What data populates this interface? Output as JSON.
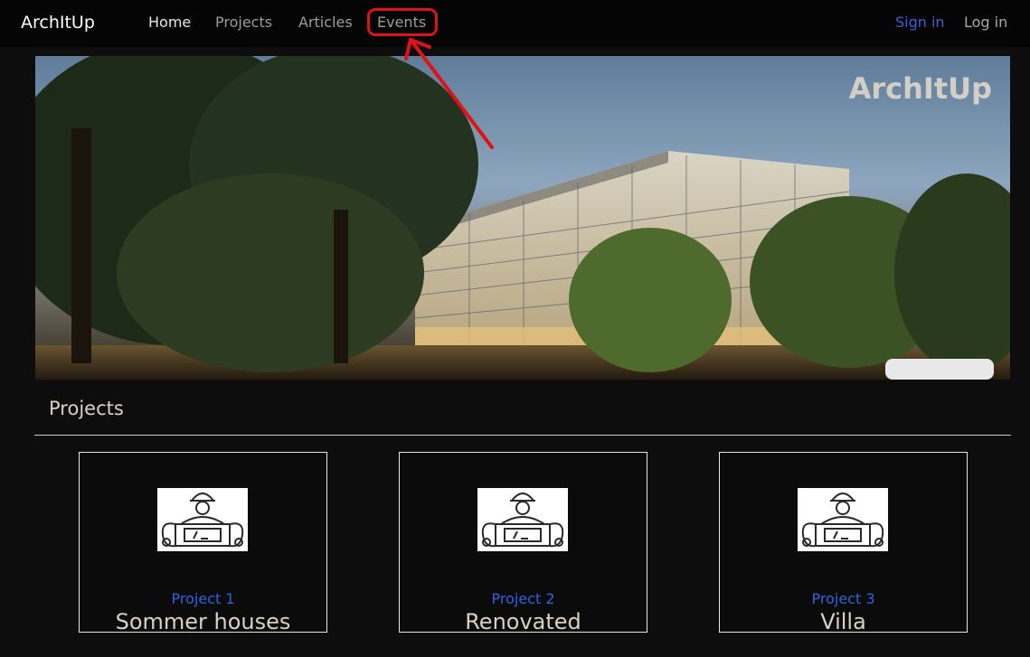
{
  "navbar": {
    "brand": "ArchItUp",
    "links": [
      "Home",
      "Projects",
      "Articles",
      "Events"
    ],
    "sign_in": "Sign in",
    "log_in": "Log in"
  },
  "hero": {
    "logo": "ArchItUp"
  },
  "projects_section": {
    "title": "Projects",
    "cards": [
      {
        "link": "Project 1",
        "desc": "Sommer houses",
        "icon": "architect-plans-icon"
      },
      {
        "link": "Project 2",
        "desc": "Renovated",
        "icon": "architect-plans-icon"
      },
      {
        "link": "Project 3",
        "desc": "Villa",
        "icon": "architect-plans-icon"
      }
    ]
  },
  "colors": {
    "background": "#0d0d0d",
    "navbar": "#050505",
    "link_blue": "#2f63e0",
    "annotation_red": "#e01218"
  }
}
